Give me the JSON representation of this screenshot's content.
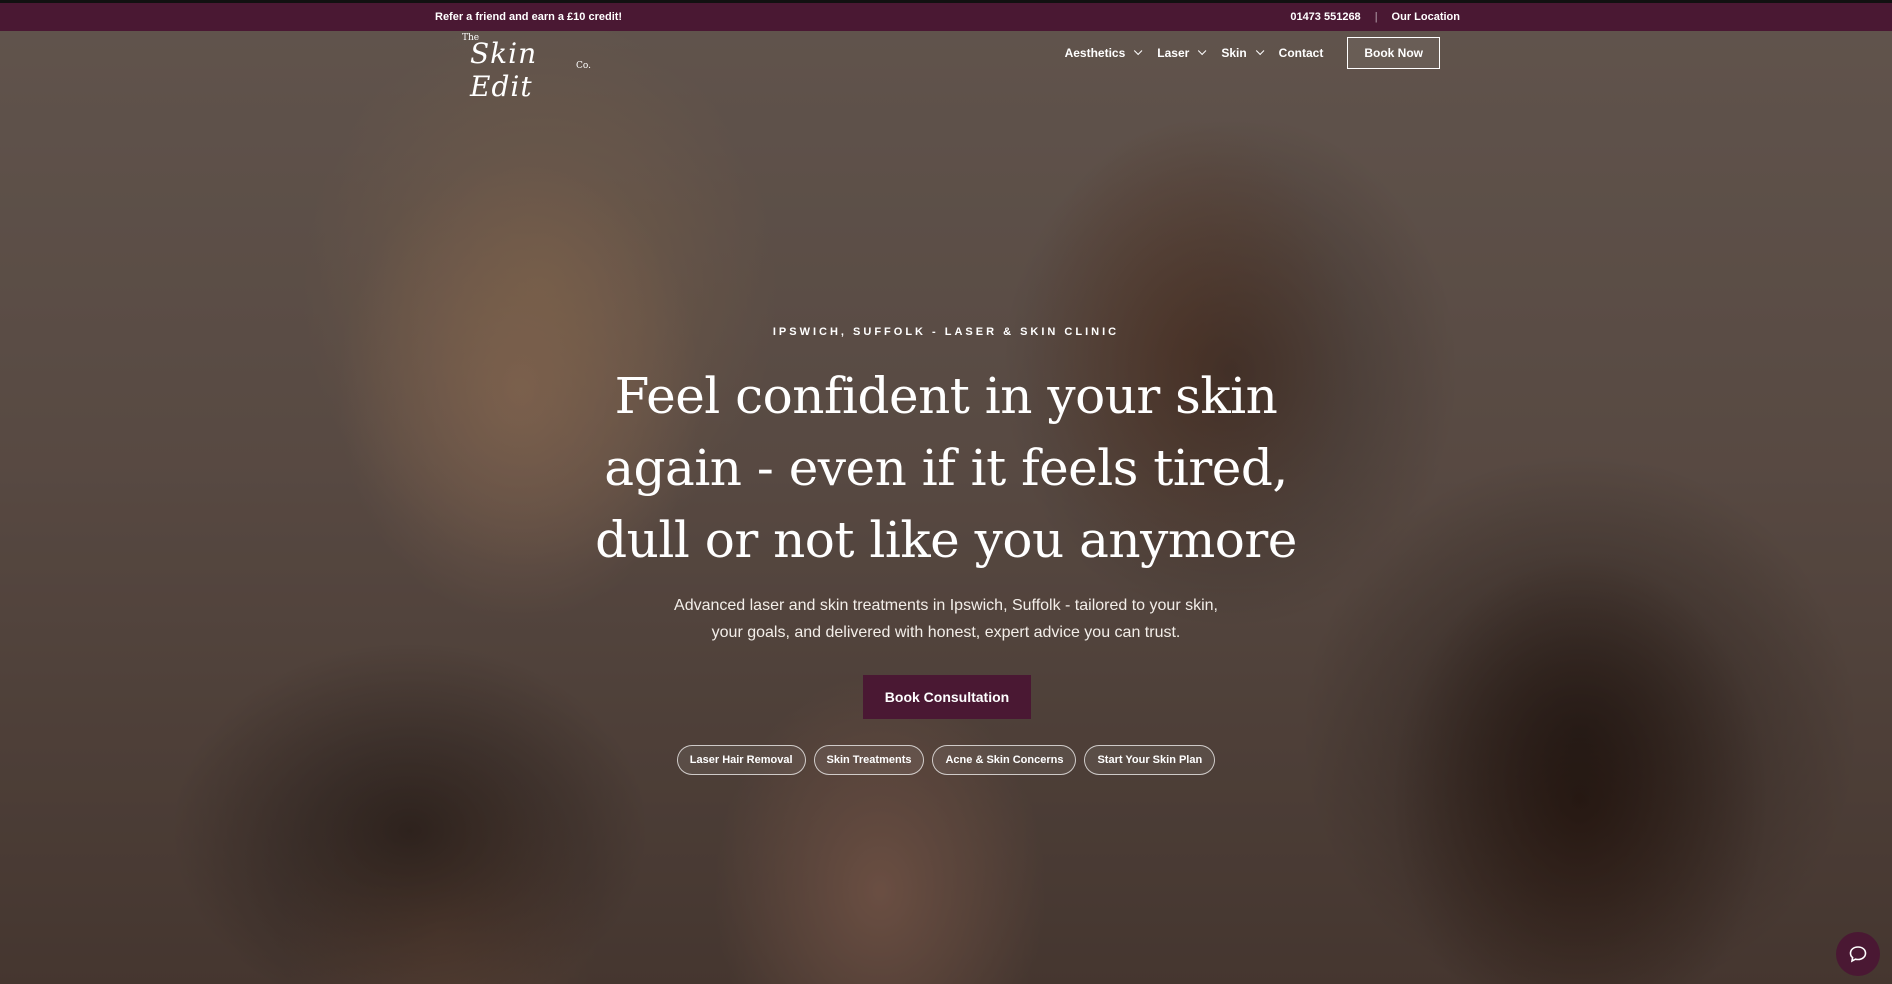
{
  "topbar": {
    "promo": "Refer a friend and earn a £10 credit!",
    "phone": "01473 551268",
    "separator": "|",
    "location": "Our Location"
  },
  "logo": {
    "the": "The",
    "main": "Skin Edit",
    "co": "Co."
  },
  "nav": {
    "items": [
      {
        "label": "Aesthetics",
        "dropdown": true
      },
      {
        "label": "Laser",
        "dropdown": true
      },
      {
        "label": "Skin",
        "dropdown": true
      },
      {
        "label": "Contact",
        "dropdown": false
      }
    ],
    "book_now": "Book Now"
  },
  "hero": {
    "eyebrow": "IPSWICH, SUFFOLK - LASER & SKIN CLINIC",
    "headline_lines": [
      "Feel confident in your skin",
      "again - even if it feels tired,",
      "dull or not like you anymore"
    ],
    "subtitle_lines": [
      "Advanced laser and skin treatments in Ipswich, Suffolk - tailored to your skin,",
      "your goals, and delivered with honest, expert advice you can trust."
    ],
    "cta": "Book Consultation",
    "pills": [
      "Laser Hair Removal",
      "Skin Treatments",
      "Acne & Skin Concerns",
      "Start Your Skin Plan"
    ]
  },
  "chat": {
    "icon": "chat-bubble-icon"
  },
  "colors": {
    "brand": "#4a1833"
  }
}
